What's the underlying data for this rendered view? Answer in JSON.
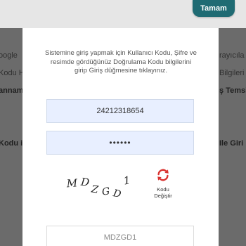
{
  "header": {
    "confirm_label": "Tamam"
  },
  "background": {
    "left_fragments": [
      "oogle",
      "Kodu Hat",
      "annam",
      "Kodu ile"
    ],
    "right_fragments": [
      "rayıcıla",
      "Bilgileri",
      "ş Temsi",
      "Ile Giri"
    ]
  },
  "modal": {
    "instructions": "Sistemine giriş yapmak için Kullanıcı Kodu, Şifre ve resimde gördüğünüz Doğrulama Kodu bilgilerini girip Giriş düğmesine tıklayınız.",
    "user_code_value": "24212318654",
    "password_value": "••••••",
    "captcha_chars": [
      "M",
      "D",
      "Z",
      "G",
      "D",
      "1"
    ],
    "refresh_label_line1": "Kodu",
    "refresh_label_line2": "Değiştir",
    "captcha_input_value": "MDZGD1"
  },
  "colors": {
    "overlay": "#6b6b6b",
    "button": "#1f6b73",
    "field_bg": "#e8efff",
    "refresh_icon": "#d9322f"
  }
}
